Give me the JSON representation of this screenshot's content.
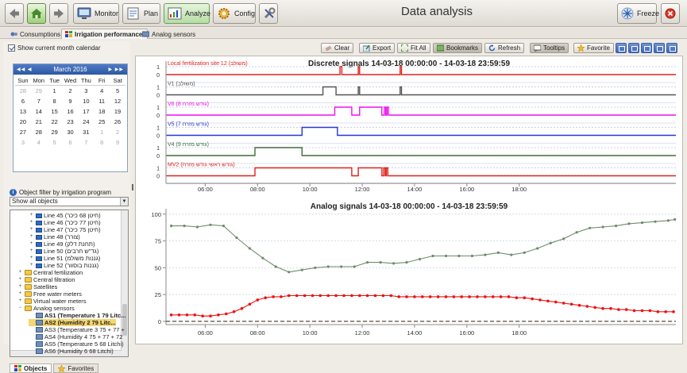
{
  "app": {
    "title": "Data analysis"
  },
  "toolbar": {
    "monitor": "Monitor",
    "plan": "Plan",
    "analyze": "Analyze",
    "config": "Config",
    "freeze": "Freeze"
  },
  "tabs": [
    {
      "label": "Consumptions"
    },
    {
      "label": "Irrigation performance"
    },
    {
      "label": "Analog sensors"
    }
  ],
  "calendar": {
    "show_label": "Show current month calendar",
    "month": "March 2016",
    "prev": "◀◀ ◀",
    "next": "▶ ▶▶",
    "day_names": [
      "Sun",
      "Mon",
      "Tue",
      "Wed",
      "Thu",
      "Fri",
      "Sat"
    ],
    "days": [
      "28",
      "29",
      "1",
      "2",
      "3",
      "4",
      "5",
      "6",
      "7",
      "8",
      "9",
      "10",
      "11",
      "12",
      "13",
      "14",
      "15",
      "16",
      "17",
      "18",
      "19",
      "20",
      "21",
      "22",
      "23",
      "24",
      "25",
      "26",
      "27",
      "28",
      "29",
      "30",
      "31",
      "1",
      "2",
      "3",
      "4",
      "5",
      "6",
      "7",
      "8",
      "9"
    ],
    "other_month": [
      0,
      1,
      33,
      34,
      35,
      36,
      37,
      38,
      39,
      40,
      41
    ]
  },
  "filter": {
    "label": "Object filter by irrigation program",
    "select_value": "Show all objects"
  },
  "tree": [
    {
      "label": "Line 45 (חיטן 68 כיכר)",
      "indent": 3,
      "icon": "line",
      "exp": "+"
    },
    {
      "label": "Line 46 (חיטן 77 כיכר)",
      "indent": 3,
      "icon": "line",
      "exp": "+"
    },
    {
      "label": "Line 47 (חיטן 75 כיכר)",
      "indent": 3,
      "icon": "line",
      "exp": "+"
    },
    {
      "label": "Line 48 (צורר)",
      "indent": 3,
      "icon": "line",
      "exp": "+"
    },
    {
      "label": "Line 49 (תחנת דלק)",
      "indent": 3,
      "icon": "line",
      "exp": "+"
    },
    {
      "label": "Line 50 (גד\"ש חרבים)",
      "indent": 3,
      "icon": "line",
      "exp": "+"
    },
    {
      "label": "Line 51 (גננות משולמ)",
      "indent": 3,
      "icon": "line",
      "exp": "+"
    },
    {
      "label": "Line 52 (גננות בוסוור)",
      "indent": 3,
      "icon": "line",
      "exp": "+"
    },
    {
      "label": "Central fertilization",
      "indent": 1,
      "icon": "folder",
      "exp": "+"
    },
    {
      "label": "Central filtration",
      "indent": 1,
      "icon": "folder",
      "exp": "+"
    },
    {
      "label": "Satellites",
      "indent": 1,
      "icon": "folder",
      "exp": "+"
    },
    {
      "label": "Free water meters",
      "indent": 1,
      "icon": "folder",
      "exp": "+"
    },
    {
      "label": "Virtual water meters",
      "indent": 1,
      "icon": "folder",
      "exp": "+"
    },
    {
      "label": "Analog sensors",
      "indent": 1,
      "icon": "folder",
      "exp": "−"
    },
    {
      "label": "AS1 (Temperature 1 79 Litc...",
      "indent": 3,
      "icon": "sensor",
      "exp": "",
      "style": "bold"
    },
    {
      "label": "AS2 (Humidity 2 79 Litc...",
      "indent": 3,
      "icon": "sensor",
      "exp": "",
      "style": "sel"
    },
    {
      "label": "AS3 (Temperature 3 75 + 77 +",
      "indent": 3,
      "icon": "sensor",
      "exp": ""
    },
    {
      "label": "AS4 (Humidity 4 75 + 77 + 72",
      "indent": 3,
      "icon": "sensor",
      "exp": ""
    },
    {
      "label": "AS5 (Temperature 5 68 Litchi)",
      "indent": 3,
      "icon": "sensor",
      "exp": ""
    },
    {
      "label": "AS6 (Humidity 6 68 Litchi)",
      "indent": 3,
      "icon": "sensor",
      "exp": ""
    }
  ],
  "bottom_tabs": {
    "objects": "Objects",
    "favorites": "Favorites"
  },
  "actions": {
    "clear": "Clear",
    "export": "Export",
    "fit_all": "Fit All",
    "bookmarks": "Bookmarks",
    "refresh": "Refresh",
    "tooltips": "Tooltips",
    "favorite": "Favorite"
  },
  "colors": {
    "red": "#e0221c",
    "gray": "#555555",
    "magenta": "#ee10ee",
    "blue": "#2636d8",
    "green": "#3f6e39",
    "analog_green": "#6e8c6a",
    "analog_red": "#ee1111"
  },
  "chart_data": [
    {
      "type": "line",
      "title": "Discrete signals 14-03-18 00:00:00 - 14-03-18 23:59:59",
      "x_tick_labels": [
        "06:00",
        "08:00",
        "10:00",
        "12:00",
        "14:00",
        "16:00",
        "18:00"
      ],
      "x_range_hours": [
        4.5,
        23.99
      ],
      "y_ticks": [
        "0",
        "1"
      ],
      "series": [
        {
          "name": "Local fertilization site 12 (משולב)",
          "color_key": "red",
          "high_intervals": [
            [
              11.15,
              11.22
            ],
            [
              11.85,
              11.9
            ],
            [
              13.45,
              13.5
            ]
          ]
        },
        {
          "name": "V1 (משולב)",
          "color_key": "gray",
          "high_intervals": [
            [
              10.5,
              11.0
            ],
            [
              11.85,
              11.9
            ],
            [
              13.45,
              13.5
            ]
          ]
        },
        {
          "name": "V6 (8 גודש מזרח)",
          "color_key": "magenta",
          "high_intervals": [
            [
              10.95,
              11.6
            ],
            [
              11.9,
              12.75
            ],
            [
              12.85,
              12.9
            ],
            [
              12.95,
              13.0
            ]
          ]
        },
        {
          "name": "V5 (7 גודש מזרח)",
          "color_key": "blue",
          "high_intervals": [
            [
              9.7,
              11.05
            ]
          ]
        },
        {
          "name": "V4 (9 גודש מזרח)",
          "color_key": "green",
          "high_intervals": [
            [
              7.9,
              9.7
            ]
          ]
        },
        {
          "name": "MV2 (גודש ראשי גודש מזרח)",
          "color_key": "red",
          "high_intervals": [
            [
              7.9,
              11.6
            ],
            [
              11.85,
              12.75
            ],
            [
              12.82,
              12.88
            ],
            [
              12.92,
              12.98
            ]
          ]
        }
      ]
    },
    {
      "type": "line",
      "title": "Analog signals 14-03-18 00:00:00 - 14-03-18 23:59:59",
      "x_tick_labels": [
        "06:00",
        "08:00",
        "10:00",
        "12:00",
        "14:00",
        "16:00",
        "18:00"
      ],
      "x_range_hours": [
        4.5,
        23.99
      ],
      "y_ticks": [
        0,
        25,
        50,
        75,
        100
      ],
      "ylim": [
        -3,
        105
      ],
      "series": [
        {
          "color_key": "analog_green",
          "x": [
            4.7,
            5.2,
            5.7,
            6.2,
            6.7,
            7.2,
            7.7,
            8.2,
            8.7,
            9.2,
            9.7,
            10.2,
            10.7,
            11.2,
            11.7,
            12.2,
            12.7,
            13.2,
            13.7,
            14.2,
            14.7,
            15.2,
            15.7,
            16.2,
            16.7,
            17.2,
            17.7,
            18.2,
            18.7,
            19.2,
            19.7,
            20.2,
            20.7,
            21.2,
            21.7,
            22.2,
            22.7,
            23.2,
            23.7,
            23.95
          ],
          "y": [
            89,
            89,
            88,
            90,
            89,
            78,
            68,
            59,
            51,
            46,
            48,
            50,
            51,
            51,
            51,
            55,
            55,
            54,
            55,
            58,
            61,
            61,
            61,
            61,
            62,
            64,
            62,
            64,
            68,
            73,
            77,
            83,
            87,
            88,
            89,
            91,
            92,
            93,
            94,
            95
          ]
        },
        {
          "color_key": "analog_red",
          "x": [
            4.7,
            5.0,
            5.3,
            5.6,
            5.9,
            6.2,
            6.5,
            6.8,
            7.1,
            7.4,
            7.7,
            8.0,
            8.3,
            8.6,
            8.9,
            9.2,
            9.5,
            9.8,
            10.1,
            10.4,
            10.7,
            11.0,
            11.3,
            11.6,
            11.9,
            12.2,
            12.5,
            12.8,
            13.1,
            13.4,
            13.7,
            14.0,
            14.3,
            14.6,
            14.9,
            15.2,
            15.5,
            15.8,
            16.1,
            16.4,
            16.7,
            17.0,
            17.3,
            17.6,
            17.9,
            18.2,
            18.5,
            18.8,
            19.1,
            19.4,
            19.7,
            20.0,
            20.3,
            20.6,
            20.9,
            21.2,
            21.5,
            21.8,
            22.1,
            22.4,
            22.7,
            23.0,
            23.3,
            23.6,
            23.9
          ],
          "y": [
            6,
            6,
            6,
            6,
            5,
            5,
            6,
            7,
            9,
            12,
            16,
            20,
            22,
            23,
            23,
            24,
            24,
            24,
            24,
            24,
            24,
            24,
            24,
            24,
            24,
            24,
            24,
            24,
            24,
            23,
            23,
            23,
            23,
            23,
            23,
            23,
            23,
            23,
            23,
            23,
            23,
            23,
            23,
            23,
            22,
            22,
            21,
            20,
            19,
            18,
            17,
            16,
            15,
            14,
            13,
            12,
            12,
            11,
            11,
            10,
            10,
            10,
            9,
            9,
            9
          ]
        },
        {
          "color_key": "gray",
          "style": "dashed",
          "x": [
            4.5,
            23.99
          ],
          "y": [
            0,
            0
          ]
        }
      ]
    }
  ]
}
